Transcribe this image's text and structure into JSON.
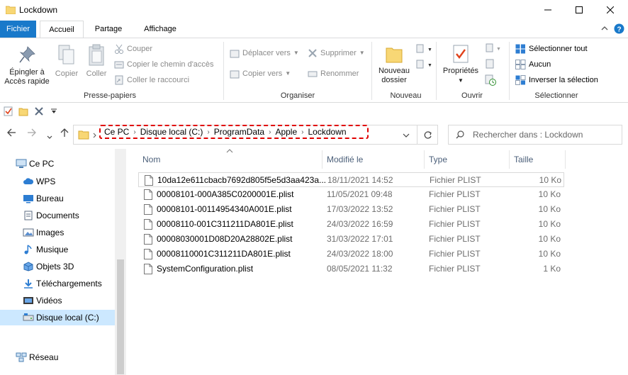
{
  "window": {
    "title": "Lockdown"
  },
  "ribbon_tabs": {
    "file": "Fichier",
    "home": "Accueil",
    "share": "Partage",
    "view": "Affichage"
  },
  "ribbon": {
    "clipboard": {
      "label": "Presse-papiers",
      "pin": "Épingler à\nAccès rapide",
      "pin_line1": "Épingler à",
      "pin_line2": "Accès rapide",
      "copy": "Copier",
      "paste": "Coller",
      "cut": "Couper",
      "copy_path": "Copier le chemin d'accès",
      "paste_shortcut": "Coller le raccourci"
    },
    "organize": {
      "label": "Organiser",
      "move_to": "Déplacer vers",
      "copy_to": "Copier vers",
      "delete": "Supprimer",
      "rename": "Renommer"
    },
    "new": {
      "label": "Nouveau",
      "new_folder_line1": "Nouveau",
      "new_folder_line2": "dossier"
    },
    "open": {
      "label": "Ouvrir",
      "properties": "Propriétés"
    },
    "select": {
      "label": "Sélectionner",
      "select_all": "Sélectionner tout",
      "select_none": "Aucun",
      "invert": "Inverser la sélection"
    }
  },
  "breadcrumb": [
    "Ce PC",
    "Disque local (C:)",
    "ProgramData",
    "Apple",
    "Lockdown"
  ],
  "search": {
    "placeholder": "Rechercher dans : Lockdown"
  },
  "sidebar": {
    "items": [
      {
        "label": "Ce PC",
        "icon": "computer-icon"
      },
      {
        "label": "WPS",
        "icon": "cloud-icon"
      },
      {
        "label": "Bureau",
        "icon": "desktop-icon"
      },
      {
        "label": "Documents",
        "icon": "documents-icon"
      },
      {
        "label": "Images",
        "icon": "images-icon"
      },
      {
        "label": "Musique",
        "icon": "music-icon"
      },
      {
        "label": "Objets 3D",
        "icon": "cube-icon"
      },
      {
        "label": "Téléchargements",
        "icon": "download-icon"
      },
      {
        "label": "Vidéos",
        "icon": "video-icon"
      },
      {
        "label": "Disque local (C:)",
        "icon": "drive-icon"
      },
      {
        "label": "Réseau",
        "icon": "network-icon"
      }
    ]
  },
  "columns": {
    "name": "Nom",
    "modified": "Modifié le",
    "type": "Type",
    "size": "Taille"
  },
  "files": [
    {
      "name": "10da12e611cbacb7692d805f5e5d3aa423a...",
      "modified": "18/11/2021 14:52",
      "type": "Fichier PLIST",
      "size": "10 Ko"
    },
    {
      "name": "00008101-000A385C0200001E.plist",
      "modified": "11/05/2021 09:48",
      "type": "Fichier PLIST",
      "size": "10 Ko"
    },
    {
      "name": "00008101-00114954340A001E.plist",
      "modified": "17/03/2022 13:52",
      "type": "Fichier PLIST",
      "size": "10 Ko"
    },
    {
      "name": "00008110-001C311211DA801E.plist",
      "modified": "24/03/2022 16:59",
      "type": "Fichier PLIST",
      "size": "10 Ko"
    },
    {
      "name": "00008030001D08D20A28802E.plist",
      "modified": "31/03/2022 17:01",
      "type": "Fichier PLIST",
      "size": "10 Ko"
    },
    {
      "name": "00008110001C311211DA801E.plist",
      "modified": "24/03/2022 18:00",
      "type": "Fichier PLIST",
      "size": "10 Ko"
    },
    {
      "name": "SystemConfiguration.plist",
      "modified": "08/05/2021 11:32",
      "type": "Fichier PLIST",
      "size": "1 Ko"
    }
  ],
  "colors": {
    "accent": "#1979ca",
    "selection": "#cce8ff",
    "highlight": "#e00000",
    "folder": "#f8d775"
  }
}
